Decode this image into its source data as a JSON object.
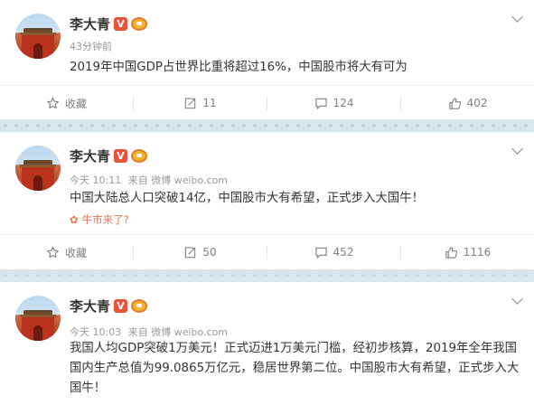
{
  "posts": [
    {
      "author": "李大青",
      "time": "43分钟前",
      "source": "",
      "text": "2019年中国GDP占世界比重将超过16%，中国股市将大有可为",
      "tag": "",
      "actions": {
        "favorite": "收藏",
        "repost": "11",
        "comment": "124",
        "like": "402"
      }
    },
    {
      "author": "李大青",
      "time": "今天 10:11",
      "source": "来自 微博 weibo.com",
      "text": "中国大陆总人口突破14亿，中国股市大有希望，正式步入大国牛！",
      "tag": "牛市来了?",
      "actions": {
        "favorite": "收藏",
        "repost": "50",
        "comment": "452",
        "like": "1116"
      }
    },
    {
      "author": "李大青",
      "time": "今天 10:03",
      "source": "来自 微博 weibo.com",
      "text": "我国人均GDP突破1万美元！正式迈进1万美元门槛，经初步核算，2019年全年我国国内生产总值为99.0865万亿元，稳居世界第二位。中国股市大有希望，正式步入大国牛！",
      "tag": "",
      "actions": {
        "favorite": "",
        "repost": "",
        "comment": "",
        "like": ""
      }
    }
  ],
  "badges": {
    "verified": "V"
  },
  "colors": {
    "accent": "#eb7350",
    "verified": "#e8543a",
    "divider": "#d9e6ee",
    "action_text": "#808080"
  }
}
